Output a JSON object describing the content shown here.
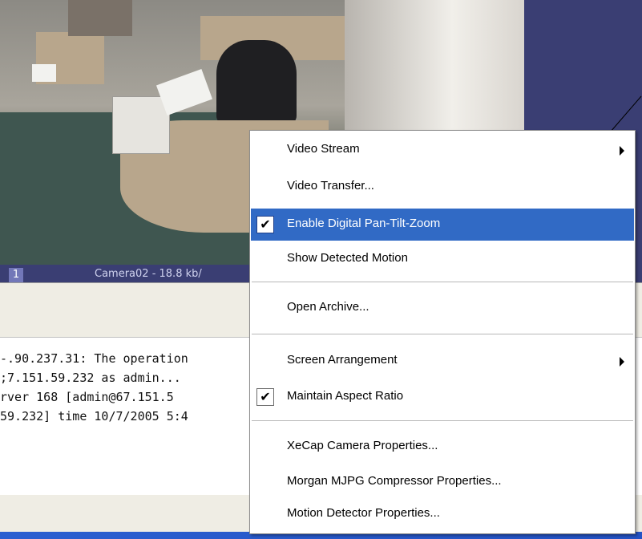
{
  "video": {
    "camera_number": "1",
    "camera_label": "Camera02 - 18.8 kb/"
  },
  "log": {
    "lines": [
      "-.90.237.31: The operation",
      ";7.151.59.232 as admin...",
      "rver 168 [admin@67.151.5",
      "59.232] time 10/7/2005 5:4"
    ]
  },
  "menu": {
    "items": [
      {
        "label": "Video Stream",
        "checked": false,
        "submenu": true
      },
      {
        "label": "Video Transfer...",
        "checked": false,
        "submenu": false
      },
      {
        "label": "Enable Digital Pan-Tilt-Zoom",
        "checked": true,
        "submenu": false,
        "highlighted": true
      },
      {
        "label": "Show Detected Motion",
        "checked": false,
        "submenu": false
      },
      {
        "label": "Open Archive...",
        "checked": false,
        "submenu": false
      },
      {
        "label": "Screen Arrangement",
        "checked": false,
        "submenu": true
      },
      {
        "label": "Maintain Aspect Ratio",
        "checked": true,
        "submenu": false
      },
      {
        "label": "XeCap Camera Properties...",
        "checked": false,
        "submenu": false
      },
      {
        "label": "Morgan MJPG Compressor Properties...",
        "checked": false,
        "submenu": false
      },
      {
        "label": "Motion Detector Properties...",
        "checked": false,
        "submenu": false
      }
    ],
    "check_glyph": "✔"
  },
  "colors": {
    "highlight": "#316ac5",
    "status_bar": "#3a3e73"
  }
}
